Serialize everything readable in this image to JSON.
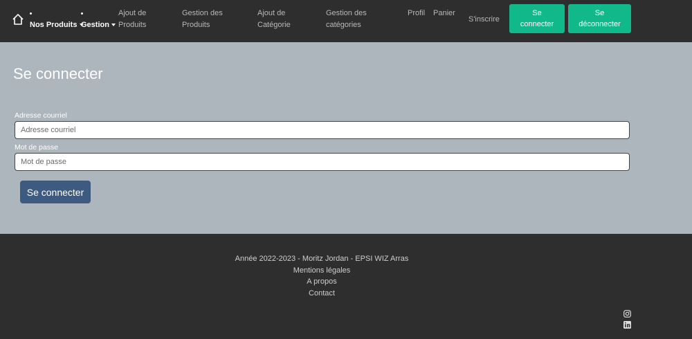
{
  "navbar": {
    "home_icon": "home-icon",
    "dropdown_products": "Nos Produits",
    "dropdown_gestion": "Gestion",
    "links": {
      "ajout_produits": "Ajout de Produits",
      "gestion_produits": "Gestion des Produits",
      "ajout_categorie": "Ajout de Catégorie",
      "gestion_categories": "Gestion des catégories",
      "profil": "Profil",
      "panier": "Panier",
      "inscrire": "S'inscrire"
    },
    "buttons": {
      "connect": "Se connecter",
      "disconnect": "Se déconnecter"
    },
    "accent": "#11b98a"
  },
  "main": {
    "title": "Se connecter",
    "email_label": "Adresse courriel",
    "email_placeholder": "Adresse courriel",
    "password_label": "Mot de passe",
    "password_placeholder": "Mot de passe",
    "submit": "Se connecter",
    "background": "#adb5bd",
    "button_color": "#3d5a80"
  },
  "footer": {
    "credits": "Année 2022-2023 - Moritz Jordan - EPSI WIZ Arras",
    "legal": "Mentions légales",
    "about": "A propos",
    "contact": "Contact",
    "social_icons": [
      "instagram-icon",
      "linkedin-icon"
    ]
  }
}
